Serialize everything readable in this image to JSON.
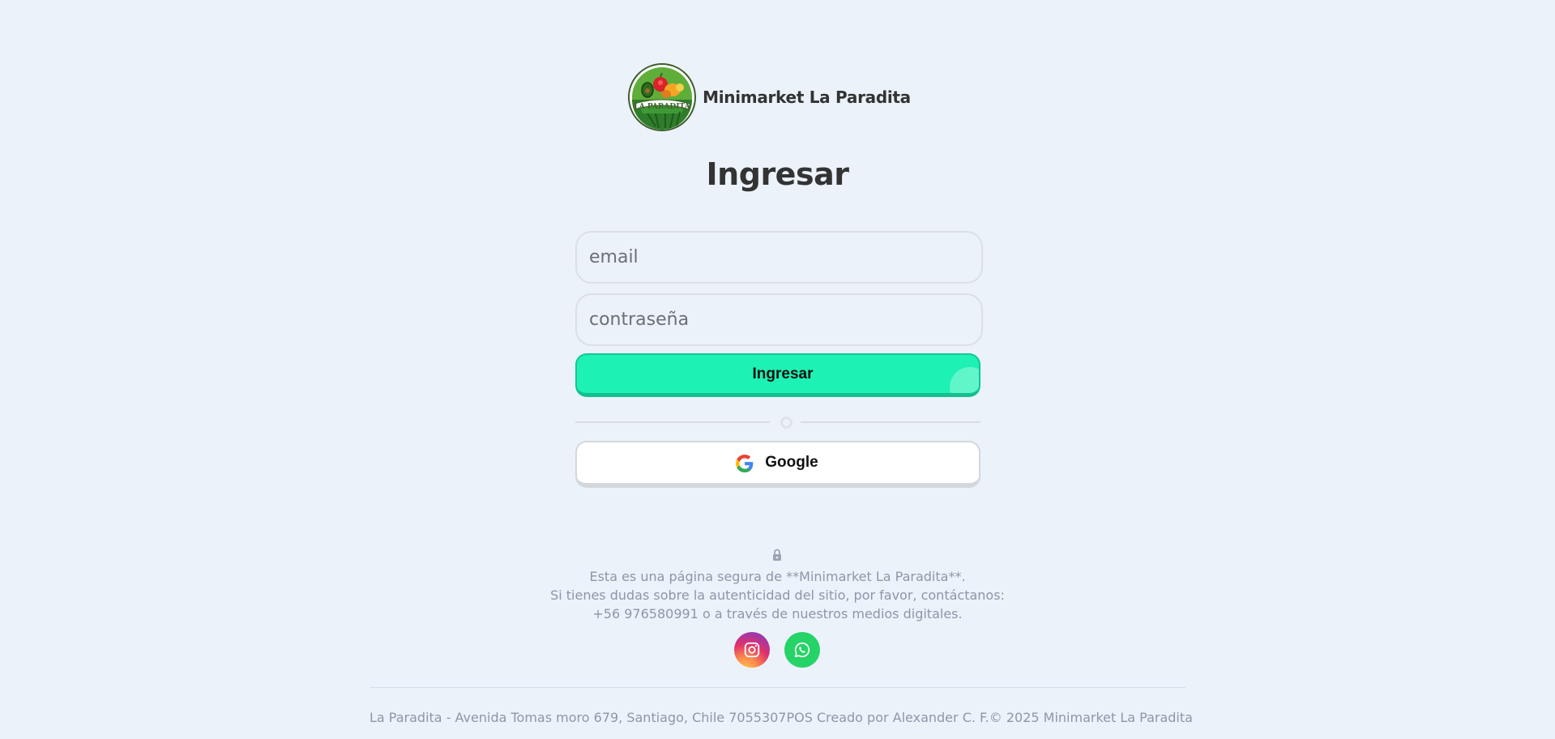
{
  "brand": {
    "name": "Minimarket La Paradita",
    "logo_text": "LA PARADITA"
  },
  "login": {
    "title": "Ingresar",
    "email_placeholder": "email",
    "password_placeholder": "contraseña",
    "submit_label": "Ingresar",
    "google_label": "Google"
  },
  "notice": {
    "lines": [
      "Esta es una página segura de **Minimarket La Paradita**.",
      "Si tienes dudas sobre la autenticidad del sitio, por favor, contáctanos:",
      "+56 976580991 o a través de nuestros medios digitales."
    ]
  },
  "social": {
    "icons": [
      "instagram-icon",
      "whatsapp-icon"
    ]
  },
  "footer": {
    "address": "La Paradita - Avenida Tomas moro 679, Santiago, Chile 7055307",
    "credit": "POS Creado por Alexander C. F.",
    "copyright": "© 2025 Minimarket La Paradita"
  },
  "colors": {
    "background": "#ebf2fa",
    "primary_button": "#1df2b4",
    "primary_button_border": "#12c895",
    "instagram": "#e1306c",
    "whatsapp": "#25d366",
    "muted_text": "#8d97a8"
  }
}
